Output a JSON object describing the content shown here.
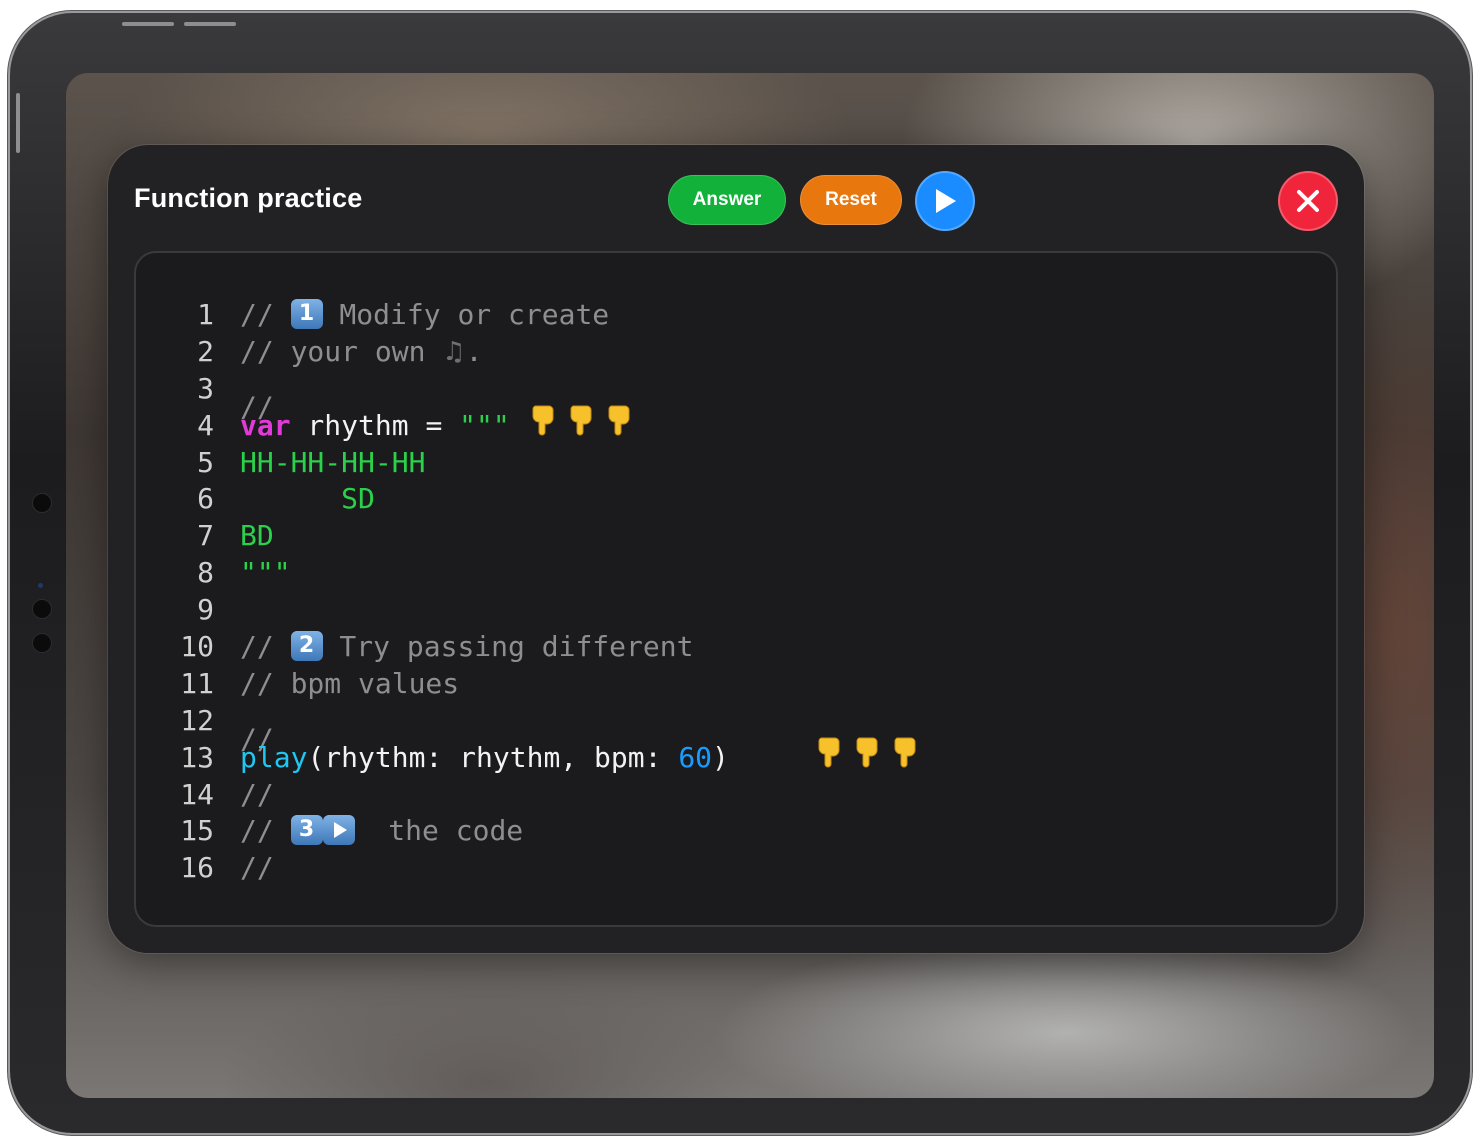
{
  "window": {
    "title": "Function practice"
  },
  "toolbar": {
    "answer_label": "Answer",
    "reset_label": "Reset",
    "run_icon": "play-icon",
    "close_icon": "close-icon"
  },
  "colors": {
    "answer": "#12b23a",
    "reset": "#e8770e",
    "run": "#1a8cff",
    "close": "#f0243a",
    "keyword": "#e03ad8",
    "string": "#2bd14a",
    "function": "#1ec8f0",
    "number": "#1a9cff",
    "comment": "#8e8e92"
  },
  "code": {
    "line_numbers": [
      "1",
      "2",
      "3",
      "4",
      "5",
      "6",
      "7",
      "8",
      "9",
      "10",
      "11",
      "12",
      "13",
      "14",
      "15",
      "16"
    ],
    "l1": {
      "prefix": "// ",
      "emoji": "1",
      "text": " Modify or create"
    },
    "l2": {
      "text": "// your own ",
      "suffix": "."
    },
    "l3": {
      "text": "// "
    },
    "l4": {
      "kw": "var",
      "plain": " rhythm = ",
      "str": "\"\"\""
    },
    "l5": {
      "str": "HH-HH-HH-HH"
    },
    "l6": {
      "str": "      SD"
    },
    "l7": {
      "str": "BD"
    },
    "l8": {
      "str": "\"\"\""
    },
    "l9": {
      "text": ""
    },
    "l10": {
      "prefix": "// ",
      "emoji": "2",
      "text": " Try passing different"
    },
    "l11": {
      "text": "// bpm values"
    },
    "l12": {
      "text": "//                  "
    },
    "l13": {
      "fn": "play",
      "plain1": "(rhythm: rhythm, bpm: ",
      "num": "60",
      "plain2": ")"
    },
    "l14": {
      "text": "//"
    },
    "l15": {
      "prefix": "// ",
      "emoji": "3",
      "text": "  the code"
    },
    "l16": {
      "text": "//"
    }
  }
}
